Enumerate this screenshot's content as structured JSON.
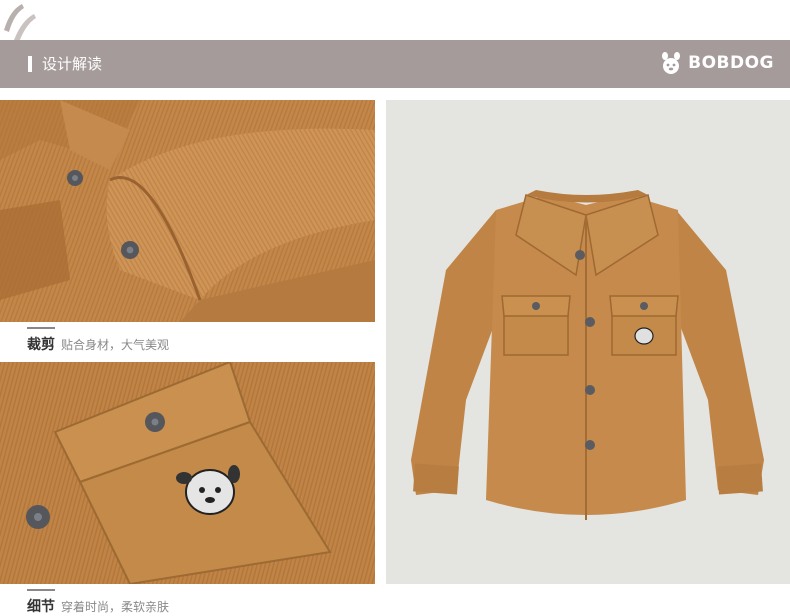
{
  "header": {
    "section_title": "设计解读",
    "brand_name": "BOBDOG",
    "brand_icon": "bobdog-logo-icon"
  },
  "captions": [
    {
      "title": "裁剪",
      "description": "贴合身材，大气美观"
    },
    {
      "title": "细节",
      "description": "穿着时尚，柔软亲肤"
    }
  ],
  "colors": {
    "header_bg": "#a59b9a",
    "shirt": "#c08448",
    "backdrop": "#e4e4e0"
  }
}
